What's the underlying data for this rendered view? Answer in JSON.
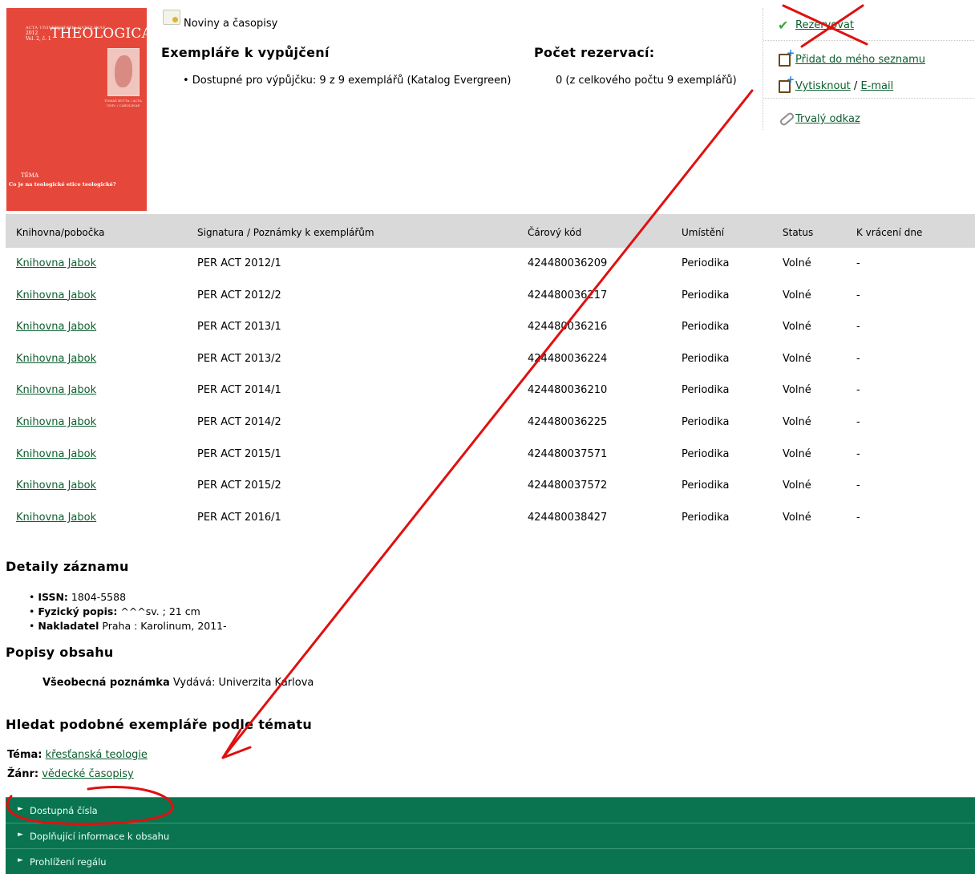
{
  "cover": {
    "series": "ACTA UNIVERSITATIS CAROLINAE",
    "year": "2012",
    "volume": "Vol. 2, č. 1",
    "title": "THEOLOGICA",
    "meta": "TOMÁŠ BUTTA / ACTA UNIV. / CAROLINAE",
    "tema_label": "TÉMA",
    "tema_question": "Co je na teologické etice teologické?"
  },
  "format": {
    "label": "Noviny a časopisy",
    "icon": "newspaper-icon"
  },
  "holdings": {
    "title": "Exempláře k vypůjčení",
    "text": "• Dostupné pro výpůjčku: 9 z 9 exemplářů (Katalog Evergreen)"
  },
  "holds": {
    "title": "Počet rezervací:",
    "text": "0 (z celkového počtu 9 exemplářů)"
  },
  "actions": {
    "reserve": "Rezervovat",
    "add_list": "Přidat do mého seznamu",
    "print": "Vytisknout",
    "separator": "/",
    "email": "E-mail",
    "permalink": "Trvalý odkaz"
  },
  "table": {
    "headers": [
      "Knihovna/pobočka",
      "Signatura / Poznámky k exemplářům",
      "Čárový kód",
      "Umístění",
      "Status",
      "K vrácení dne"
    ],
    "rows": [
      [
        "Knihovna Jabok",
        "PER ACT 2012/1",
        "424480036209",
        "Periodika",
        "Volné",
        "-"
      ],
      [
        "Knihovna Jabok",
        "PER ACT 2012/2",
        "424480036217",
        "Periodika",
        "Volné",
        "-"
      ],
      [
        "Knihovna Jabok",
        "PER ACT 2013/1",
        "424480036216",
        "Periodika",
        "Volné",
        "-"
      ],
      [
        "Knihovna Jabok",
        "PER ACT 2013/2",
        "424480036224",
        "Periodika",
        "Volné",
        "-"
      ],
      [
        "Knihovna Jabok",
        "PER ACT 2014/1",
        "424480036210",
        "Periodika",
        "Volné",
        "-"
      ],
      [
        "Knihovna Jabok",
        "PER ACT 2014/2",
        "424480036225",
        "Periodika",
        "Volné",
        "-"
      ],
      [
        "Knihovna Jabok",
        "PER ACT 2015/1",
        "424480037571",
        "Periodika",
        "Volné",
        "-"
      ],
      [
        "Knihovna Jabok",
        "PER ACT 2015/2",
        "424480037572",
        "Periodika",
        "Volné",
        "-"
      ],
      [
        "Knihovna Jabok",
        "PER ACT 2016/1",
        "424480038427",
        "Periodika",
        "Volné",
        "-"
      ]
    ]
  },
  "details": {
    "title": "Detaily záznamu",
    "issn_label": "ISSN:",
    "issn": "1804-5588",
    "physical_label": "Fyzický popis:",
    "physical": "^^^sv. ; 21 cm",
    "publisher_label": "Nakladatel",
    "publisher": "Praha : Karolinum, 2011-"
  },
  "content": {
    "title": "Popisy obsahu",
    "note_label": "Všeobecná poznámka",
    "note": "Vydává: Univerzita Karlova"
  },
  "similar": {
    "title": "Hledat podobné exempláře podle tématu",
    "topic_label": "Téma:",
    "topic": "křesťanská teologie",
    "genre_label": "Žánr:",
    "genre": "vědecké časopisy"
  },
  "bars": [
    "Dostupná čísla",
    "Doplňující informace k obsahu",
    "Prohlížení regálu"
  ],
  "colors": {
    "link": "#0b5e2e",
    "bar": "#0a7450",
    "annotation": "#e01010",
    "cover": "#e5483a"
  }
}
